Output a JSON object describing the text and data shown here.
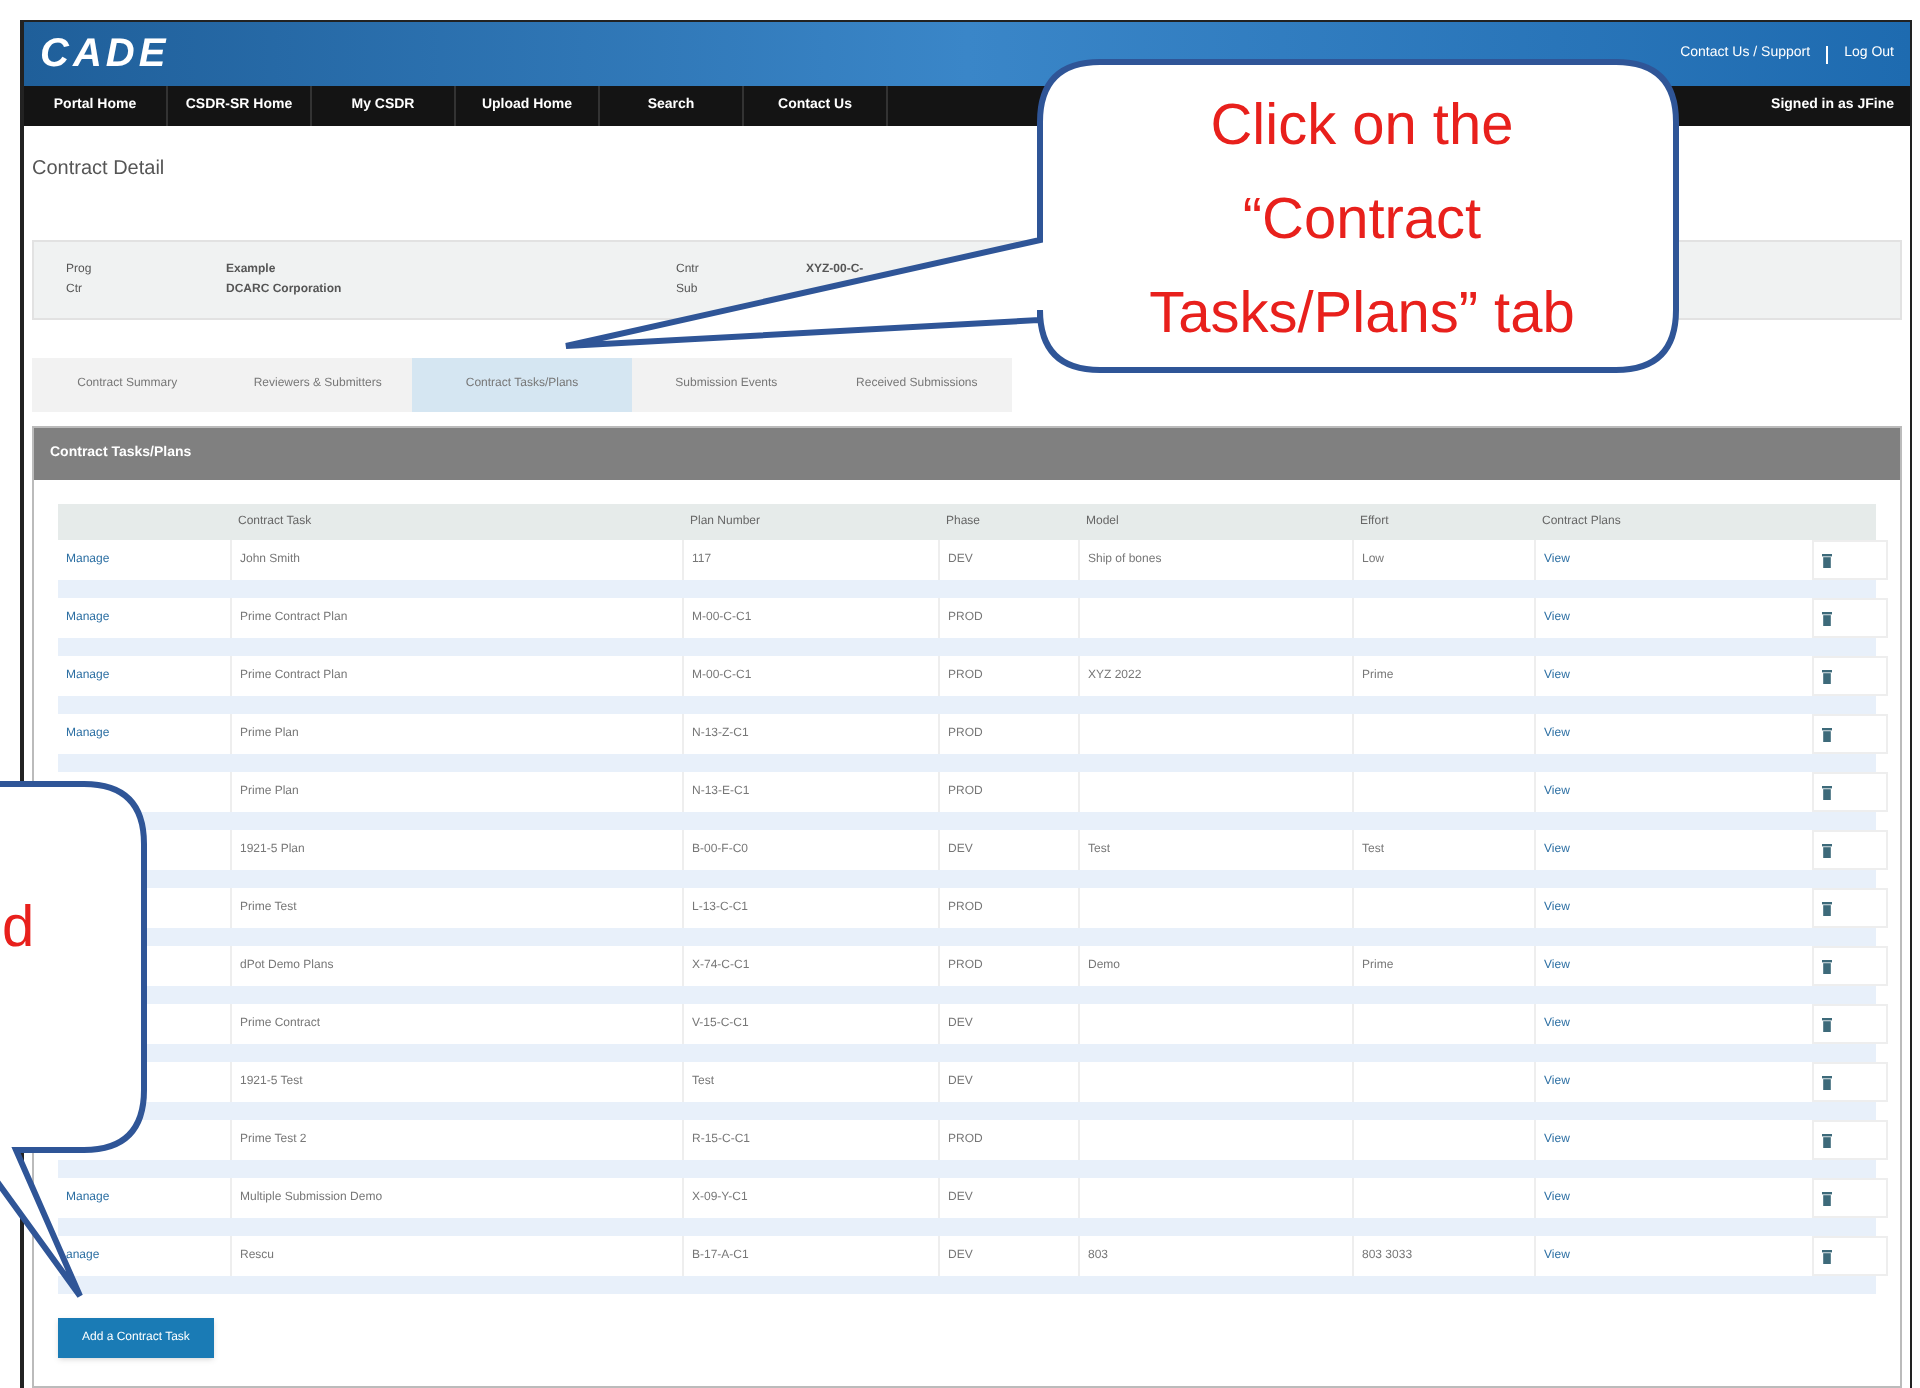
{
  "header": {
    "logo": "CADE",
    "links": [
      "Contact Us / Support",
      "Log Out"
    ]
  },
  "nav": {
    "items": [
      "Portal Home",
      "CSDR-SR Home",
      "My CSDR",
      "Upload Home",
      "Search",
      "Contact Us"
    ],
    "user": "Signed in as JFine"
  },
  "page_title": "Contract Detail",
  "info": [
    {
      "label": "Prog",
      "value": "Example"
    },
    {
      "label": "Ctr",
      "value": "DCARC Corporation"
    },
    {
      "label": "Cntr",
      "value": "XYZ-00-C-"
    },
    {
      "label": "Sub"
    }
  ],
  "tabs": [
    {
      "label": "Contract Summary",
      "selected": false
    },
    {
      "label": "Reviewers & Submitters",
      "selected": false
    },
    {
      "label": "Contract Tasks/Plans",
      "selected": true
    },
    {
      "label": "Submission Events",
      "selected": false
    },
    {
      "label": "Received Submissions",
      "selected": false
    }
  ],
  "panel_title": "Contract Tasks/Plans",
  "table": {
    "columns": [
      "Contract Task",
      "Plan Number",
      "Phase",
      "Model",
      "Effort",
      "Contract Plans"
    ],
    "rows": [
      {
        "manage": "Manage",
        "task": "John Smith",
        "plan": "117",
        "phase": "DEV",
        "model": "Ship of bones",
        "effort": "Low",
        "plans": "View"
      },
      {
        "manage": "Manage",
        "task": "Prime Contract Plan",
        "plan": "M-00-C-C1",
        "phase": "PROD",
        "plans": "View"
      },
      {
        "manage": "Manage",
        "task": "Prime Contract Plan",
        "plan": "M-00-C-C1",
        "phase": "PROD",
        "model": "XYZ 2022",
        "effort": "Prime",
        "plans": "View"
      },
      {
        "manage": "Manage",
        "task": "Prime Plan",
        "plan": "N-13-Z-C1",
        "phase": "PROD",
        "plans": "View"
      },
      {
        "task": "Prime Plan",
        "plan": "N-13-E-C1",
        "phase": "PROD",
        "plans": "View"
      },
      {
        "task": "1921-5 Plan",
        "plan": "B-00-F-C0",
        "phase": "DEV",
        "model": "Test",
        "effort": "Test",
        "plans": "View"
      },
      {
        "task": "Prime Test",
        "plan": "L-13-C-C1",
        "phase": "PROD",
        "plans": "View"
      },
      {
        "task": "dPot Demo Plans",
        "plan": "X-74-C-C1",
        "phase": "PROD",
        "model": "Demo",
        "effort": "Prime",
        "plans": "View"
      },
      {
        "task": "Prime Contract",
        "plan": "V-15-C-C1",
        "phase": "DEV",
        "plans": "View"
      },
      {
        "task": "1921-5 Test",
        "plan": "Test",
        "phase": "DEV",
        "plans": "View"
      },
      {
        "task": "Prime Test 2",
        "plan": "R-15-C-C1",
        "phase": "PROD",
        "plans": "View"
      },
      {
        "manage": "Manage",
        "task": "Multiple Submission Demo",
        "plan": "X-09-Y-C1",
        "phase": "DEV",
        "plans": "View"
      },
      {
        "manage": "anage",
        "task": "Rescu",
        "plan": "B-17-A-C1",
        "phase": "DEV",
        "model": "803",
        "effort": "803 3033",
        "plans": "View"
      }
    ]
  },
  "add_button": "Add a Contract Task",
  "callouts": [
    {
      "kind": "right",
      "text": "Click on the “Contract Tasks/Plans” tab"
    },
    {
      "kind": "left",
      "text": "d"
    }
  ]
}
